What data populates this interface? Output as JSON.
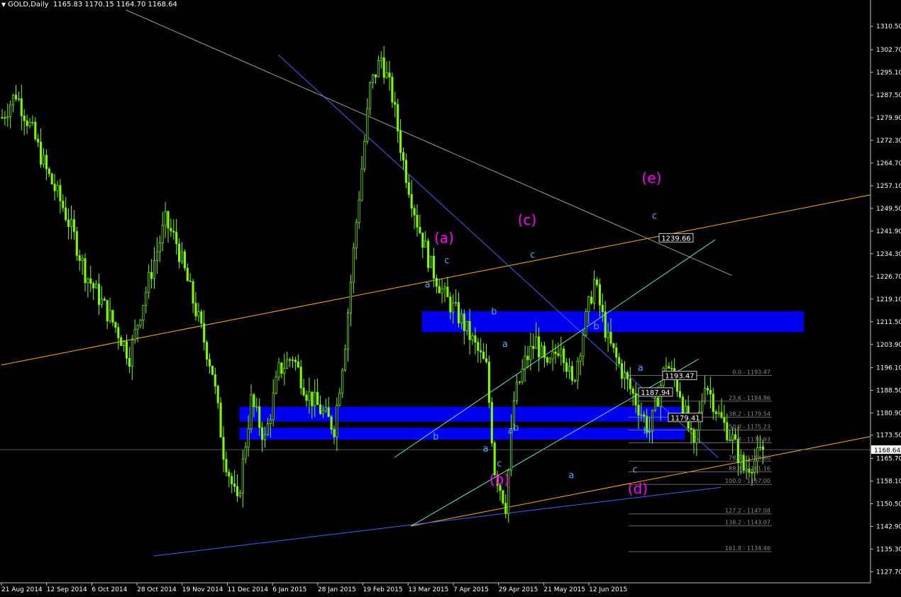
{
  "header": {
    "symbol": "GOLD,Daily",
    "ohlc": "1165.83 1170.15 1164.70 1168.64"
  },
  "colors": {
    "background": "#000000",
    "candle": "#7CFC00",
    "wave_label_major": "#FF00FF",
    "wave_label_minor": "#4FA7FF",
    "zone": "#0000EE",
    "trend_orange": "#FFB000",
    "trend_blue": "#4060FF",
    "trend_cyan": "#66E0C0",
    "arrow": "#8A8AD0",
    "fib": "#8A8A8A"
  },
  "chart_data": {
    "type": "candlestick",
    "instrument": "GOLD",
    "timeframe": "Daily",
    "last_price": 1168.64,
    "ylim": [
      1124.0,
      1316.0
    ],
    "y_ticks": [
      "1310.50",
      "1302.70",
      "1295.10",
      "1287.50",
      "1279.90",
      "1272.30",
      "1264.70",
      "1257.10",
      "1249.50",
      "1241.90",
      "1234.30",
      "1226.70",
      "1219.10",
      "1211.50",
      "1203.90",
      "1196.10",
      "1188.50",
      "1180.90",
      "1173.50",
      "1165.70",
      "1158.10",
      "1150.50",
      "1142.90",
      "1135.30",
      "1127.70"
    ],
    "x_ticks": [
      "21 Aug 2014",
      "12 Sep 2014",
      "6 Oct 2014",
      "28 Oct 2014",
      "19 Nov 2014",
      "11 Dec 2014",
      "6 Jan 2015",
      "28 Jan 2015",
      "19 Feb 2015",
      "13 Mar 2015",
      "7 Apr 2015",
      "29 Apr 2015",
      "21 May 2015",
      "12 Jun 2015"
    ],
    "path_bars": [
      0,
      5,
      11,
      16,
      22,
      26,
      30,
      36,
      42,
      46,
      50,
      55,
      59,
      63,
      67,
      71,
      76,
      80,
      85,
      90,
      95,
      100,
      105,
      110,
      115,
      120,
      124,
      128,
      133,
      137,
      141,
      145,
      150,
      155,
      160,
      166,
      170,
      175,
      178,
      182,
      185,
      189,
      193,
      197,
      202,
      206,
      210,
      214,
      219,
      224,
      229,
      234,
      240,
      245,
      250,
      254,
      259,
      264,
      268,
      272,
      275
    ],
    "path_closes": [
      1280,
      1288,
      1275,
      1262,
      1250,
      1240,
      1228,
      1218,
      1208,
      1200,
      1215,
      1232,
      1245,
      1238,
      1225,
      1212,
      1195,
      1168,
      1150,
      1185,
      1172,
      1195,
      1200,
      1188,
      1182,
      1176,
      1205,
      1245,
      1290,
      1300,
      1287,
      1265,
      1245,
      1230,
      1220,
      1212,
      1205,
      1196,
      1162,
      1150,
      1185,
      1198,
      1205,
      1195,
      1205,
      1190,
      1208,
      1225,
      1205,
      1195,
      1185,
      1175,
      1198,
      1188,
      1168,
      1192,
      1180,
      1172,
      1162,
      1165,
      1168.64
    ],
    "wave_labels": [
      {
        "text": "(a)",
        "price": 1238.0,
        "bar": 160,
        "major": true
      },
      {
        "text": "(b)",
        "price": 1157.0,
        "bar": 180,
        "major": true
      },
      {
        "text": "(c)",
        "price": 1244.0,
        "bar": 190,
        "major": true
      },
      {
        "text": "(d)",
        "price": 1154.0,
        "bar": 230,
        "major": true
      },
      {
        "text": "(e)",
        "price": 1258.0,
        "bar": 235,
        "major": true
      },
      {
        "text": "a",
        "price": 1223.0,
        "bar": 154,
        "major": false
      },
      {
        "text": "c",
        "price": 1231.0,
        "bar": 161,
        "major": false
      },
      {
        "text": "b",
        "price": 1172.0,
        "bar": 157,
        "major": false
      },
      {
        "text": "b",
        "price": 1214.0,
        "bar": 178,
        "major": false
      },
      {
        "text": "a",
        "price": 1203.0,
        "bar": 182,
        "major": false
      },
      {
        "text": "a",
        "price": 1168.0,
        "bar": 175,
        "major": false
      },
      {
        "text": "c",
        "price": 1163.0,
        "bar": 180,
        "major": false
      },
      {
        "text": "a",
        "price": 1174.0,
        "bar": 184,
        "major": false
      },
      {
        "text": "b",
        "price": 1175.0,
        "bar": 186,
        "major": false
      },
      {
        "text": "c",
        "price": 1233.0,
        "bar": 192,
        "major": false
      },
      {
        "text": "b",
        "price": 1209.0,
        "bar": 215,
        "major": false
      },
      {
        "text": "a",
        "price": 1159.0,
        "bar": 206,
        "major": false
      },
      {
        "text": "a",
        "price": 1195.0,
        "bar": 231,
        "major": false
      },
      {
        "text": "b",
        "price": 1174.0,
        "bar": 233,
        "major": false
      },
      {
        "text": "c",
        "price": 1161.0,
        "bar": 229,
        "major": false
      },
      {
        "text": "c",
        "price": 1246.0,
        "bar": 236,
        "major": false
      }
    ],
    "price_callouts": [
      "1239.66",
      "1193.47",
      "1187.94",
      "1179.41"
    ],
    "fib_levels": [
      {
        "label": "0.0 - 1193.47",
        "price": 1193.47
      },
      {
        "label": "23.6 - 1184.86",
        "price": 1184.86
      },
      {
        "label": "38.2 - 1179.54",
        "price": 1179.54
      },
      {
        "label": "50.0 - 1175.23",
        "price": 1175.23
      },
      {
        "label": "61.8 - 1170.93",
        "price": 1170.93
      },
      {
        "label": "78.6 - 1164.80",
        "price": 1164.8
      },
      {
        "label": "88.6 - 1161.16",
        "price": 1161.16
      },
      {
        "label": "100.0 - 1157.00",
        "price": 1157.0
      },
      {
        "label": "127.2 - 1147.08",
        "price": 1147.08
      },
      {
        "label": "138.2 - 1143.07",
        "price": 1143.07
      },
      {
        "label": "161.8 - 1134.46",
        "price": 1134.46
      }
    ],
    "zones": [
      {
        "name": "upper-resistance-zone",
        "price_top": 1215.0,
        "price_bottom": 1208.0,
        "bar_start": 152,
        "bar_end": 290
      },
      {
        "name": "support-zone-top",
        "price_top": 1183.0,
        "price_bottom": 1178.0,
        "bar_start": 86,
        "bar_end": 247
      },
      {
        "name": "support-zone-bottom",
        "price_top": 1176.0,
        "price_bottom": 1172.0,
        "bar_start": 86,
        "bar_end": 247
      }
    ],
    "trendlines": [
      {
        "name": "orange-upper-channel",
        "color": "orange",
        "p1": {
          "bar": 0,
          "price": 1197
        },
        "p2": {
          "bar": 314,
          "price": 1254
        }
      },
      {
        "name": "orange-lower-channel",
        "color": "orange",
        "p1": {
          "bar": 148,
          "price": 1143
        },
        "p2": {
          "bar": 314,
          "price": 1173
        }
      },
      {
        "name": "blue-lower-support",
        "color": "blue",
        "p1": {
          "bar": 55,
          "price": 1133
        },
        "p2": {
          "bar": 260,
          "price": 1156
        }
      },
      {
        "name": "blue-descending",
        "color": "blue",
        "p1": {
          "bar": 100,
          "price": 1301
        },
        "p2": {
          "bar": 259,
          "price": 1166
        }
      },
      {
        "name": "gray-descending",
        "color": "gray",
        "p1": {
          "bar": 45,
          "price": 1316
        },
        "p2": {
          "bar": 264,
          "price": 1227
        }
      },
      {
        "name": "cyan-rising",
        "color": "cyan",
        "p1": {
          "bar": 148,
          "price": 1143
        },
        "p2": {
          "bar": 252,
          "price": 1199
        }
      },
      {
        "name": "cyan-mid",
        "color": "cyan",
        "p1": {
          "bar": 142,
          "price": 1166
        },
        "p2": {
          "bar": 258,
          "price": 1239
        }
      }
    ]
  }
}
